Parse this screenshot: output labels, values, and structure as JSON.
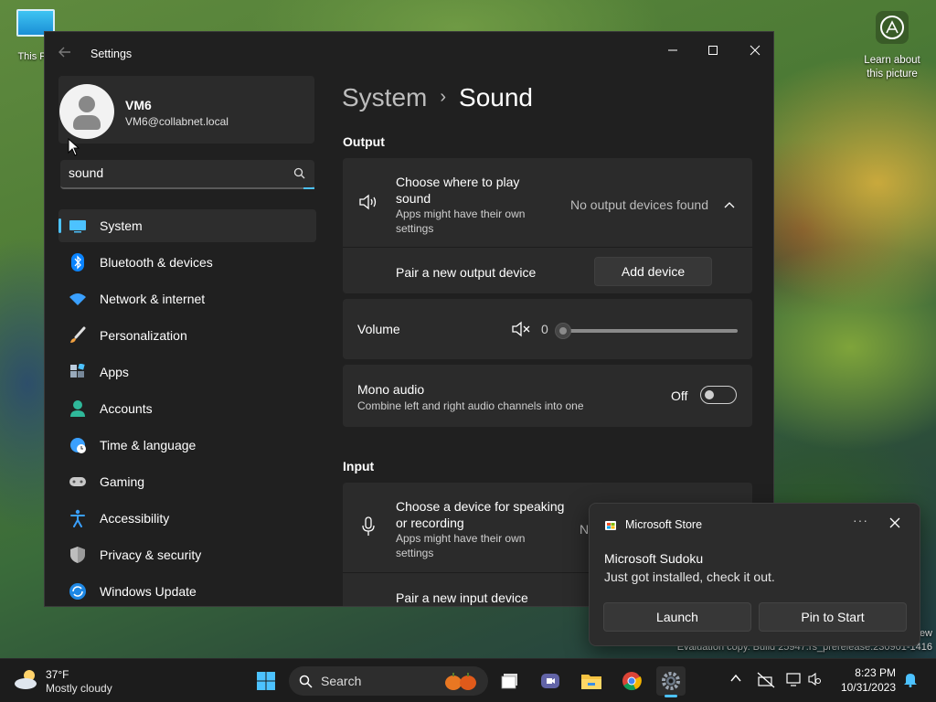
{
  "desktop": {
    "this_pc_label": "This PC",
    "learn_label_1": "Learn about",
    "learn_label_2": "this picture",
    "watermark_1": "ew",
    "watermark_2": "Evaluation copy. Build 25947.rs_prerelease.230901-1416"
  },
  "window": {
    "title": "Settings"
  },
  "profile": {
    "name": "VM6",
    "email": "VM6@collabnet.local"
  },
  "search": {
    "value": "sound"
  },
  "nav": {
    "items": [
      {
        "label": "System"
      },
      {
        "label": "Bluetooth & devices"
      },
      {
        "label": "Network & internet"
      },
      {
        "label": "Personalization"
      },
      {
        "label": "Apps"
      },
      {
        "label": "Accounts"
      },
      {
        "label": "Time & language"
      },
      {
        "label": "Gaming"
      },
      {
        "label": "Accessibility"
      },
      {
        "label": "Privacy & security"
      },
      {
        "label": "Windows Update"
      }
    ]
  },
  "breadcrumb": {
    "parent": "System",
    "separator": "›",
    "current": "Sound"
  },
  "output": {
    "heading": "Output",
    "choose_title_1": "Choose where to play",
    "choose_title_2": "sound",
    "choose_sub_1": "Apps might have their own",
    "choose_sub_2": "settings",
    "status": "No output devices found",
    "pair_label": "Pair a new output device",
    "add_device_label": "Add device"
  },
  "volume": {
    "label": "Volume",
    "value": "0"
  },
  "mono": {
    "title": "Mono audio",
    "subtitle": "Combine left and right audio channels into one",
    "state": "Off"
  },
  "input": {
    "heading": "Input",
    "choose_title_1": "Choose a device for speaking",
    "choose_title_2": "or recording",
    "choose_sub_1": "Apps might have their own",
    "choose_sub_2": "settings",
    "status_partial": "N",
    "pair_label": "Pair a new input device"
  },
  "toast": {
    "app_name": "Microsoft Store",
    "more_label": "···",
    "title": "Microsoft Sudoku",
    "body": "Just got installed, check it out.",
    "launch_label": "Launch",
    "pin_label": "Pin to Start"
  },
  "taskbar": {
    "temp": "37°F",
    "condition": "Mostly cloudy",
    "search_label": "Search",
    "time": "8:23 PM",
    "date": "10/31/2023"
  }
}
